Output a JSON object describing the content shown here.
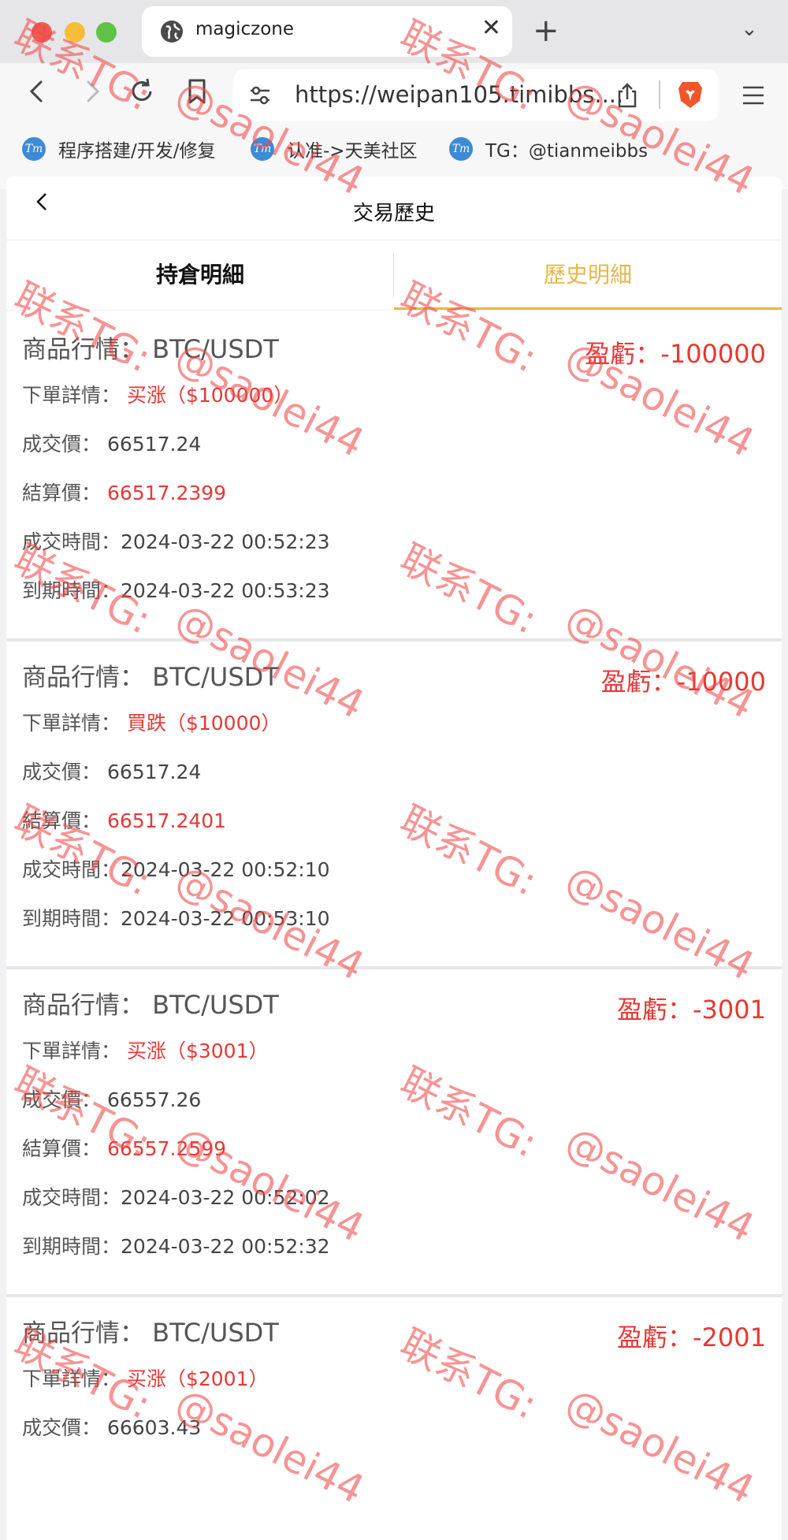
{
  "browser": {
    "tab_title": "magiczone",
    "url": "https://weipan105.timibbs....",
    "bookmarks": [
      {
        "label": "程序搭建/开发/修复"
      },
      {
        "label": "认准->天美社区"
      },
      {
        "label": "TG：@tianmeibbs"
      }
    ],
    "icons": [
      "globe-icon",
      "close-icon",
      "plus-icon",
      "chevron-down-icon",
      "back-icon",
      "forward-icon",
      "reload-icon",
      "bookmark-icon",
      "site-settings-icon",
      "share-icon",
      "brave-lion-icon",
      "menu-icon"
    ]
  },
  "app": {
    "title": "交易歷史",
    "tabs": [
      "持倉明細",
      "歷史明細"
    ],
    "active_tab": "歷史明細",
    "labels": {
      "symbol": "商品行情：",
      "order": "下單詳情：",
      "entry": "成交價：",
      "settle": "結算價：",
      "open_time": "成交時間：",
      "expire_time": "到期時間："
    },
    "trades": [
      {
        "symbol": "BTC/USDT",
        "pl": "盈虧：-100000",
        "order": "买涨（$100000）",
        "entry": "66517.24",
        "settle": "66517.2399",
        "open_time": "2024-03-22 00:52:23",
        "expire_time": "2024-03-22 00:53:23"
      },
      {
        "symbol": "BTC/USDT",
        "pl": "盈虧：-10000",
        "order": "買跌（$10000）",
        "entry": "66517.24",
        "settle": "66517.2401",
        "open_time": "2024-03-22 00:52:10",
        "expire_time": "2024-03-22 00:53:10"
      },
      {
        "symbol": "BTC/USDT",
        "pl": "盈虧：-3001",
        "order": "买涨（$3001）",
        "entry": "66557.26",
        "settle": "66557.2599",
        "open_time": "2024-03-22 00:52:02",
        "expire_time": "2024-03-22 00:52:32"
      },
      {
        "symbol": "BTC/USDT",
        "pl": "盈虧：-2001",
        "order": "买涨（$2001）",
        "entry": "66603.43"
      }
    ]
  },
  "watermark": {
    "line1": "联系TG:",
    "line2": "@saolei44"
  },
  "colors": {
    "accent": "#e8b74a",
    "loss": "#e53935"
  }
}
